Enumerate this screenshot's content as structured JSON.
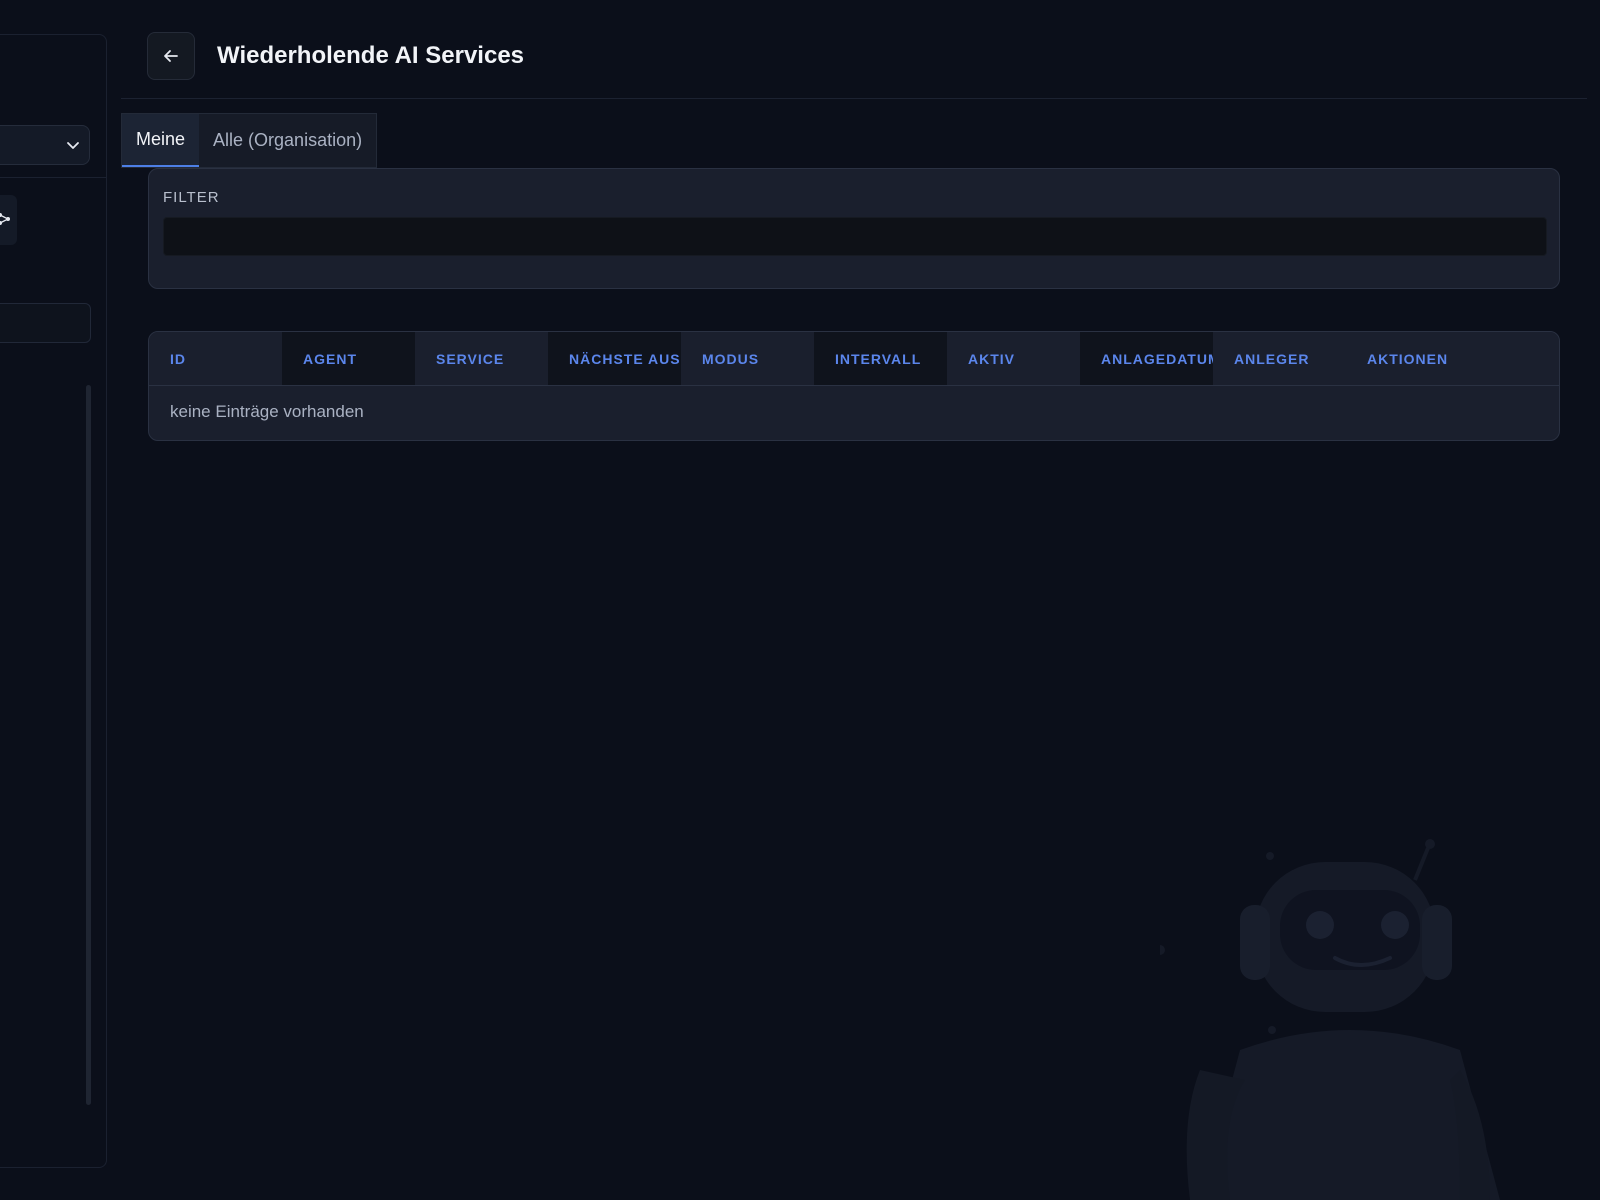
{
  "header": {
    "title": "Wiederholende AI Services",
    "back_icon": "arrow-left-icon"
  },
  "tabs": [
    {
      "label": "Meine",
      "active": true
    },
    {
      "label": "Alle (Organisation)",
      "active": false
    }
  ],
  "filter": {
    "label": "FILTER",
    "value": "",
    "placeholder": ""
  },
  "table": {
    "columns": [
      "ID",
      "AGENT",
      "SERVICE",
      "NÄCHSTE AUSF",
      "MODUS",
      "INTERVALL",
      "AKTIV",
      "ANLAGEDATUM",
      "ANLEGER",
      "AKTIONEN"
    ],
    "rows": [],
    "empty_text": "keine Einträge vorhanden"
  },
  "colors": {
    "background": "#0b0f1a",
    "card": "#1a1f2d",
    "accent": "#4d7fe6",
    "header_text": "#5b86ec"
  }
}
